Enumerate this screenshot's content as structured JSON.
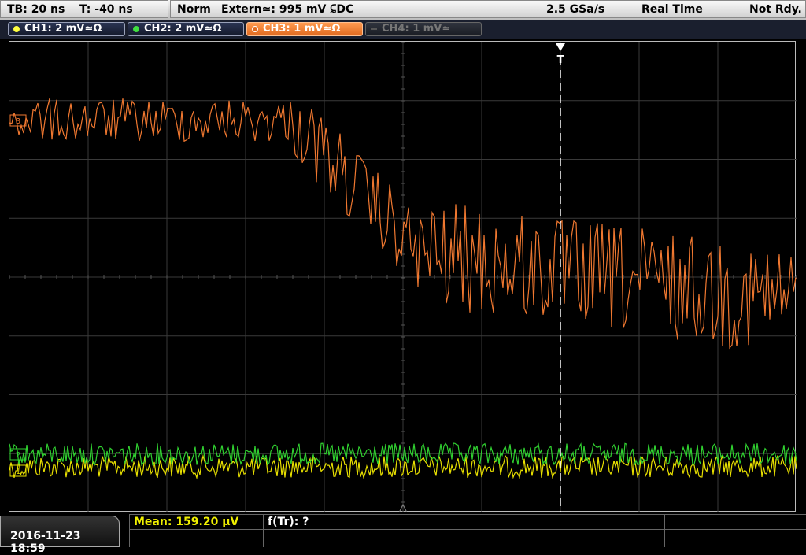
{
  "topbar": {
    "tb_label": "TB: 20 ns",
    "t_label": "T: -40 ns",
    "mode": "Norm",
    "trigger": "Extern≃: 995 mV ⫇DC",
    "sample_rate": "2.5 GSa/s",
    "acq_mode": "Real Time",
    "status": "Not Rdy."
  },
  "channels": [
    {
      "label": "CH1: 2 mV≃Ω",
      "color": "#f0e000",
      "dot": "#ffff40"
    },
    {
      "label": "CH2: 2 mV≃Ω",
      "color": "#ffffff",
      "dot": "#40e040"
    },
    {
      "label": "CH3: 1 mV≃Ω",
      "color": "#ffffff",
      "dot": "#ff8030"
    },
    {
      "label": "CH4: 1 mV≃",
      "color": "#888888",
      "dot": "#666666"
    }
  ],
  "markers": {
    "ch3": "3",
    "ch2": "2",
    "ch1": "1",
    "trigger": "T"
  },
  "footer": {
    "datetime": "2016-11-23 18:59",
    "mean": "Mean: 159.20 µV",
    "ftr": "f(Tr): ?"
  },
  "colors": {
    "ch1": "#e8e000",
    "ch2": "#30d030",
    "ch3": "#f07830",
    "ch4": "#666666",
    "grid": "#3a3a3a",
    "trigger_line": "#ffffff"
  }
}
